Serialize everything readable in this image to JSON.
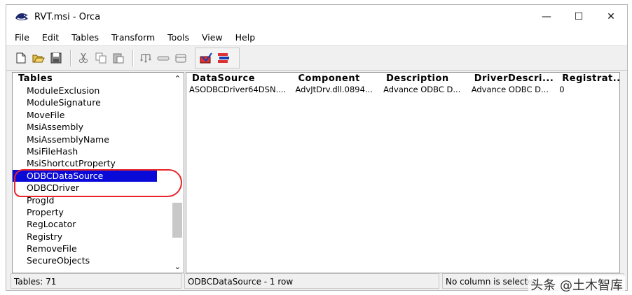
{
  "window": {
    "title": "RVT.msi - Orca",
    "controls": {
      "minimize": "—",
      "maximize": "☐",
      "close": "✕"
    }
  },
  "menu": [
    "File",
    "Edit",
    "Tables",
    "Transform",
    "Tools",
    "View",
    "Help"
  ],
  "toolbar": {
    "icons": [
      "new-icon",
      "open-icon",
      "save-icon",
      "cut-icon",
      "copy-icon",
      "paste-icon",
      "tree-icon",
      "link-icon",
      "table-icon",
      "validate-icon",
      "transform-icon"
    ]
  },
  "tables_panel": {
    "header": "Tables",
    "items": [
      "ModuleExclusion",
      "ModuleSignature",
      "MoveFile",
      "MsiAssembly",
      "MsiAssemblyName",
      "MsiFileHash",
      "MsiShortcutProperty",
      "ODBCDataSource",
      "ODBCDriver",
      "ProgId",
      "Property",
      "RegLocator",
      "Registry",
      "RemoveFile",
      "SecureObjects"
    ],
    "selected": "ODBCDataSource"
  },
  "grid": {
    "columns": [
      "DataSource",
      "Component",
      "Description",
      "DriverDescri...",
      "Registrat..."
    ],
    "rows": [
      [
        "ASODBCDriver64DSN....",
        "AdvJtDrv.dll.0894...",
        "Advance ODBC D...",
        "Advance ODBC D...",
        "0"
      ]
    ]
  },
  "status": {
    "tables_count": "Tables: 71",
    "table_info": "ODBCDataSource - 1 row",
    "column_info": "No column is selected."
  },
  "watermark": "头条 @土木智库",
  "colors": {
    "selection": "#0a0ad8",
    "annotation": "#e8242a"
  }
}
